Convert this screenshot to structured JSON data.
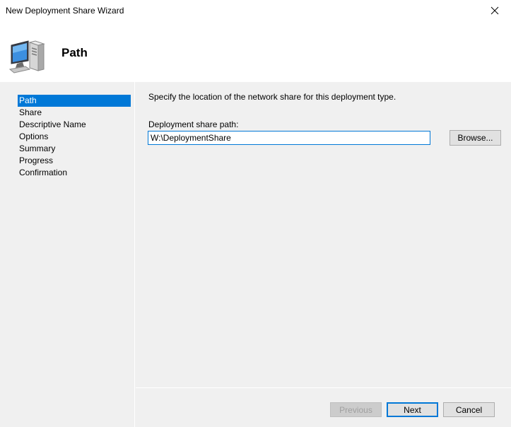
{
  "window": {
    "title": "New Deployment Share Wizard",
    "close_icon": "close-icon"
  },
  "header": {
    "title": "Path",
    "icon": "computer-icon"
  },
  "sidebar": {
    "items": [
      {
        "label": "Path",
        "selected": true
      },
      {
        "label": "Share",
        "selected": false
      },
      {
        "label": "Descriptive Name",
        "selected": false
      },
      {
        "label": "Options",
        "selected": false
      },
      {
        "label": "Summary",
        "selected": false
      },
      {
        "label": "Progress",
        "selected": false
      },
      {
        "label": "Confirmation",
        "selected": false
      }
    ]
  },
  "content": {
    "instruction": "Specify the location of the network share for this deployment type.",
    "path_label": "Deployment share path:",
    "path_value": "W:\\DeploymentShare",
    "browse_label": "Browse..."
  },
  "footer": {
    "previous_label": "Previous",
    "next_label": "Next",
    "cancel_label": "Cancel"
  },
  "colors": {
    "accent": "#0078d7",
    "panel_background": "#f0f0f0",
    "button_face": "#e1e1e1"
  }
}
